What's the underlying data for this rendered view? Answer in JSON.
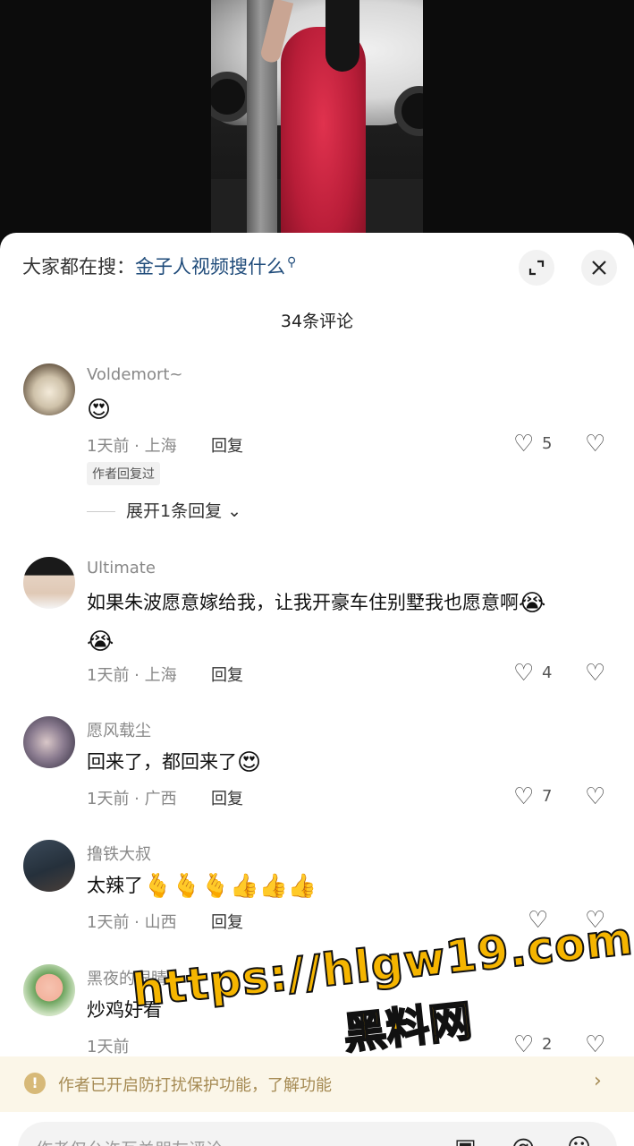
{
  "search": {
    "prefix": "大家都在搜：",
    "query": "金子人视频搜什么"
  },
  "comment_count_title": "34条评论",
  "comments": [
    {
      "username": "Voldemort~",
      "text": "",
      "emojis": [
        "😍"
      ],
      "time_location": "1天前 · 上海",
      "reply_label": "回复",
      "likes": "5",
      "author_badge": "作者回复过",
      "expand_replies": "展开1条回复"
    },
    {
      "username": "Ultimate",
      "text": "如果朱波愿意嫁给我，让我开豪车住别墅我也愿意啊",
      "emojis": [
        "😭",
        "😭"
      ],
      "time_location": "1天前 · 上海",
      "reply_label": "回复",
      "likes": "4"
    },
    {
      "username": "愿风载尘",
      "text": "回来了，都回来了",
      "emojis": [
        "😍"
      ],
      "time_location": "1天前 · 广西",
      "reply_label": "回复",
      "likes": "7"
    },
    {
      "username": "撸铁大叔",
      "text": "太辣了",
      "emojis": [
        "🫰",
        "🫰",
        "🫰",
        "👍",
        "👍",
        "👍"
      ],
      "time_location": "1天前 · 山西",
      "reply_label": "回复",
      "likes": ""
    },
    {
      "username": "黑夜的眼睛",
      "text": "炒鸡好看",
      "emojis": [],
      "time_location": "1天前",
      "reply_label": "",
      "likes": "2"
    }
  ],
  "notice": {
    "text": "作者已开启防打扰保护功能，了解",
    "text_tail": "功能"
  },
  "input": {
    "placeholder": "作者仅允许互关朋友评论"
  },
  "watermark": {
    "url": "https://hlgw19.com",
    "site": "黑料网"
  },
  "colors": {
    "link": "#1f4b7a",
    "notice_bg": "#fbf6e8",
    "notice_text": "#a58a53",
    "watermark": "#f5b500"
  }
}
